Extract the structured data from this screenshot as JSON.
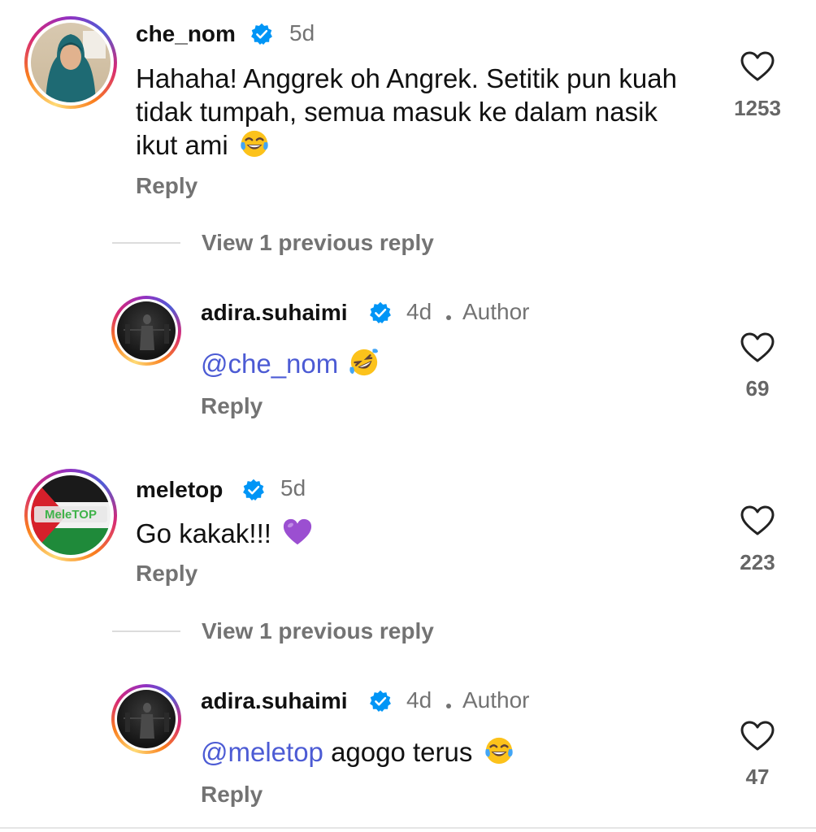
{
  "comments": [
    {
      "username": "che_nom",
      "time": "5d",
      "text": "Hahaha! Anggrek oh Angrek. Setitik pun kuah tidak tumpah, semua masuk ke dalam nasik ikut ami",
      "emoji": "tears-of-joy",
      "reply_label": "Reply",
      "likes": "1253"
    },
    {
      "username": "adira.suhaimi",
      "time": "4d",
      "author_label": "Author",
      "mention": "@che_nom",
      "text": "",
      "emoji": "rolling-on-floor-laughing",
      "reply_label": "Reply",
      "likes": "69"
    },
    {
      "username": "meletop",
      "time": "5d",
      "text": "Go kakak!!!",
      "emoji": "purple-heart",
      "reply_label": "Reply",
      "likes": "223"
    },
    {
      "username": "adira.suhaimi",
      "time": "4d",
      "author_label": "Author",
      "mention": "@meletop",
      "text": "agogo terus",
      "emoji": "tears-of-joy",
      "reply_label": "Reply",
      "likes": "47"
    }
  ],
  "view_previous": [
    "View 1 previous reply",
    "View 1 previous reply"
  ],
  "colors": {
    "mention": "#4c5bd4",
    "verified": "#0095f6",
    "secondary": "#737373"
  }
}
